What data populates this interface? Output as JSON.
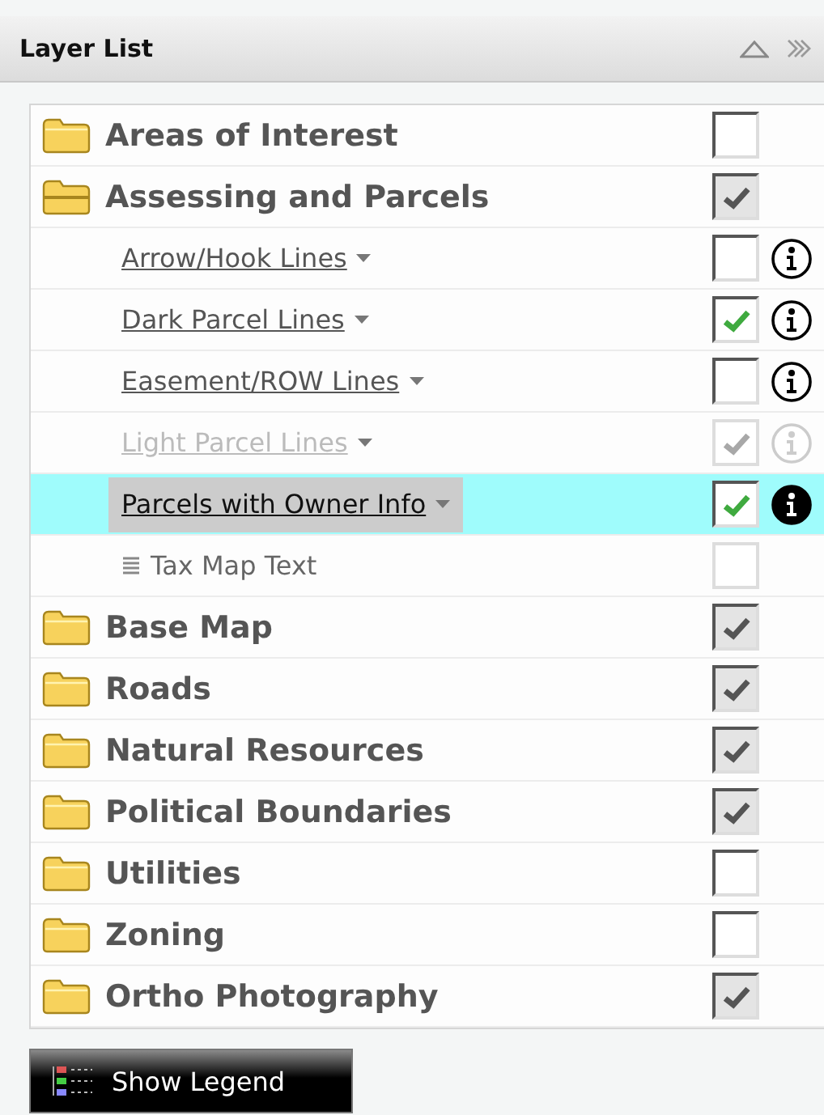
{
  "panel": {
    "title": "Layer List"
  },
  "groups": [
    {
      "name": "Areas of Interest",
      "checked": false,
      "expanded": false
    },
    {
      "name": "Assessing and Parcels",
      "checked": true,
      "expanded": true,
      "children": [
        {
          "kind": "layer",
          "name": "Arrow/Hook Lines",
          "checked": false,
          "disabled": false,
          "selected": false
        },
        {
          "kind": "layer",
          "name": "Dark Parcel Lines",
          "checked": true,
          "disabled": false,
          "selected": false
        },
        {
          "kind": "layer",
          "name": "Easement/ROW Lines",
          "checked": false,
          "disabled": false,
          "selected": false
        },
        {
          "kind": "layer",
          "name": "Light Parcel Lines",
          "checked": true,
          "disabled": true,
          "selected": false
        },
        {
          "kind": "layer",
          "name": "Parcels with Owner Info",
          "checked": true,
          "disabled": false,
          "selected": true
        },
        {
          "kind": "label",
          "name": "Tax Map Text",
          "checked": false,
          "disabled": true
        }
      ]
    },
    {
      "name": "Base Map",
      "checked": true,
      "expanded": false
    },
    {
      "name": "Roads",
      "checked": true,
      "expanded": false
    },
    {
      "name": "Natural Resources",
      "checked": true,
      "expanded": false
    },
    {
      "name": "Political Boundaries",
      "checked": true,
      "expanded": false
    },
    {
      "name": "Utilities",
      "checked": false,
      "expanded": false
    },
    {
      "name": "Zoning",
      "checked": false,
      "expanded": false
    },
    {
      "name": "Ortho Photography",
      "checked": true,
      "expanded": false
    }
  ],
  "legend_button": {
    "label": "Show Legend"
  }
}
